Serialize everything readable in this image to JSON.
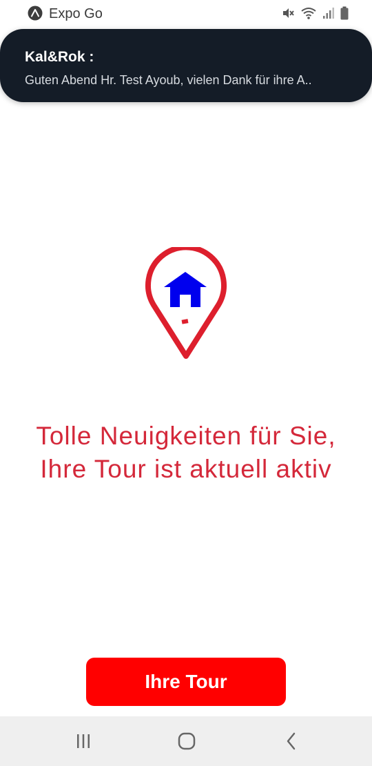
{
  "status_bar": {
    "app_name": "Expo Go",
    "app_icon": "expo-logo-icon",
    "icons": [
      "mute-icon",
      "wifi-icon",
      "signal-icon",
      "battery-icon"
    ]
  },
  "notification": {
    "title": "Kal&Rok :",
    "body": "Guten Abend Hr. Test Ayoub,  vielen Dank für ihre A.."
  },
  "main": {
    "logo_icon": "location-pin-house-icon",
    "headline_line1": "Tolle Neuigkeiten für Sie,",
    "headline_line2": "Ihre Tour ist aktuell aktiv",
    "button_label": "Ihre Tour"
  },
  "nav_bar": {
    "icons": [
      "recent-apps-icon",
      "home-icon",
      "back-icon"
    ]
  },
  "colors": {
    "notification_bg": "#141c27",
    "headline": "#d4283a",
    "button": "#ff0000",
    "pin_red": "#dd1f2d",
    "house_blue": "#0000ee"
  }
}
